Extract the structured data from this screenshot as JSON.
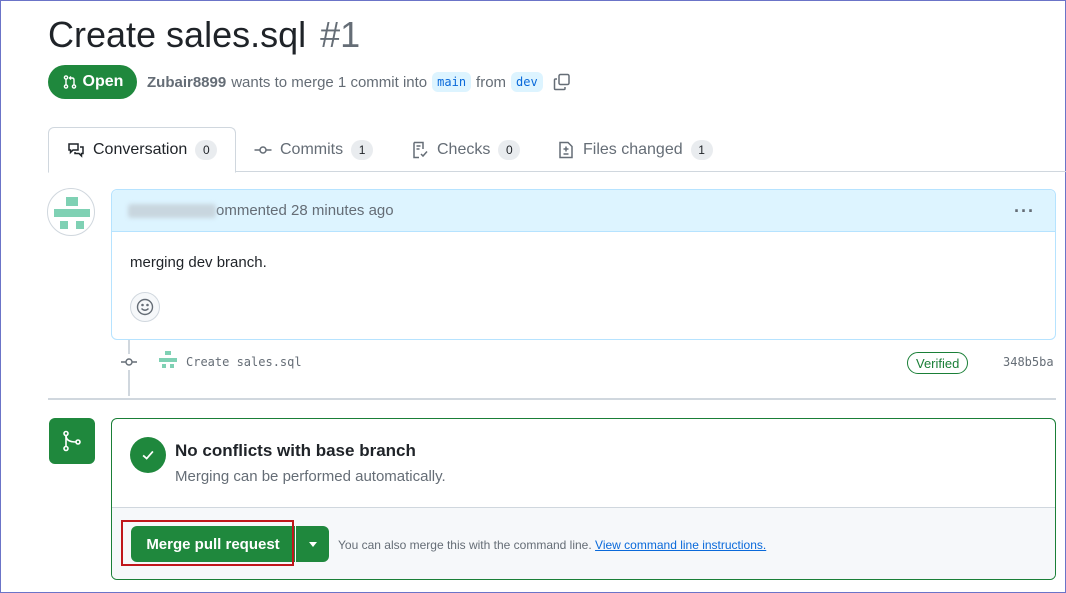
{
  "pr": {
    "title": "Create sales.sql",
    "number": "#1",
    "state": "Open",
    "author": "Zubair8899",
    "merge_text": "wants to merge 1 commit into",
    "base_branch": "main",
    "from_text": "from",
    "head_branch": "dev"
  },
  "tabs": [
    {
      "label": "Conversation",
      "count": "0",
      "icon": "comment-discussion-icon"
    },
    {
      "label": "Commits",
      "count": "1",
      "icon": "git-commit-icon"
    },
    {
      "label": "Checks",
      "count": "0",
      "icon": "checklist-icon"
    },
    {
      "label": "Files changed",
      "count": "1",
      "icon": "file-diff-icon"
    }
  ],
  "comment": {
    "header_suffix": "ommented 28 minutes ago",
    "body": "merging dev branch."
  },
  "commit": {
    "message": "Create sales.sql",
    "verified": "Verified",
    "sha": "348b5ba"
  },
  "merge": {
    "title": "No conflicts with base branch",
    "subtitle": "Merging can be performed automatically.",
    "button": "Merge pull request",
    "cli_text": "You can also merge this with the command line.",
    "cli_link": "View command line instructions."
  },
  "colors": {
    "success": "#1f883d",
    "accent": "#0969da",
    "highlight": "#c0161b"
  }
}
